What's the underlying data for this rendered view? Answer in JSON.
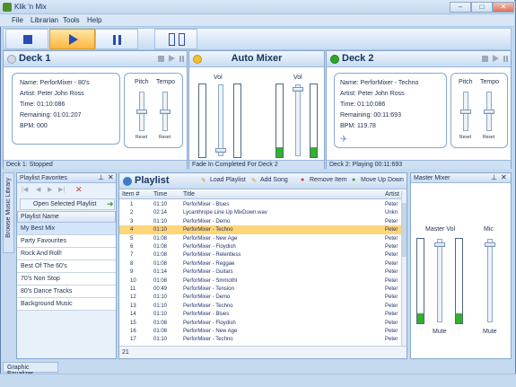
{
  "window": {
    "title": "Klik 'n Mix",
    "controls": [
      "–",
      "□",
      "✕"
    ]
  },
  "menu": [
    "File",
    "Librarian",
    "Tools",
    "Help"
  ],
  "deck1": {
    "title": "Deck 1",
    "name": "Name: PerforMixer - 80's",
    "artist": "Artist: Peter John Ross",
    "time": "Time: 01:10:086",
    "remaining": "Remaining: 01:01:207",
    "bpm": "BPM: 000",
    "pitch": "Pitch",
    "tempo": "Tempo",
    "reset": "Reset",
    "status": "Deck 1: Stopped"
  },
  "automixer": {
    "title": "Auto Mixer",
    "vol_left": "Vol",
    "vol_right": "Vol",
    "status": "Fade In Completed For Deck 2",
    "left_level": 0,
    "right_level": 0.15
  },
  "deck2": {
    "title": "Deck 2",
    "name": "Name: PerforMixer - Techno",
    "artist": "Artist: Peter John Ross",
    "time": "Time: 01:10:086",
    "remaining": "Remaining: 00:11:693",
    "bpm": "BPM: 119.78",
    "pitch": "Pitch",
    "tempo": "Tempo",
    "reset": "Reset",
    "status": "Deck 2: Playing 00:11:693"
  },
  "favorites": {
    "title": "Playlist Favorites",
    "open_button": "Open Selected Playlist",
    "column": "Playlist Name",
    "items": [
      "My Best Mix",
      "Party Favourites",
      "Rock And Roll!",
      "Best Of The 60's",
      "70's Non Stop",
      "80's Dance Tracks",
      "Background Music"
    ],
    "side_tab": "Browse Music Library"
  },
  "playlist": {
    "title": "Playlist",
    "actions": [
      "Load Playlist",
      "Add Song",
      "Remove Item",
      "Move Up Down"
    ],
    "columns": [
      "Item #",
      "Time",
      "Title",
      "Artist"
    ],
    "rows": [
      [
        "1",
        "01:10",
        "PerforMixer - Blues",
        "Peter"
      ],
      [
        "2",
        "02:14",
        "Lycanthrope Line Up MixDown.wav",
        "Unkn"
      ],
      [
        "3",
        "01:10",
        "PerforMixer - Demo",
        "Peter"
      ],
      [
        "4",
        "01:10",
        "PerforMixer - Techno",
        "Peter"
      ],
      [
        "5",
        "01:08",
        "PerforMixer - New Age",
        "Peter"
      ],
      [
        "6",
        "01:08",
        "PerforMixer - Floydish",
        "Peter"
      ],
      [
        "7",
        "01:08",
        "PerforMixer - Relentless",
        "Peter"
      ],
      [
        "8",
        "01:08",
        "PerforMixer - Reggae",
        "Peter"
      ],
      [
        "9",
        "01:14",
        "PerforMixer - Guitars",
        "Peter"
      ],
      [
        "10",
        "01:08",
        "PerforMixer - Smmothl",
        "Peter"
      ],
      [
        "11",
        "00:49",
        "PerforMixer - Tension",
        "Peter"
      ],
      [
        "12",
        "01:10",
        "PerforMixer - Demo",
        "Peter"
      ],
      [
        "13",
        "01:10",
        "PerforMixer - Techno",
        "Peter"
      ],
      [
        "14",
        "01:10",
        "PerforMixer - Blues",
        "Peter"
      ],
      [
        "15",
        "01:08",
        "PerforMixer - Floydish",
        "Peter"
      ],
      [
        "16",
        "01:08",
        "PerforMixer - New Age",
        "Peter"
      ],
      [
        "17",
        "01:10",
        "PerforMixer - Techno",
        "Peter"
      ]
    ],
    "count": "21",
    "selected_index": 3
  },
  "master": {
    "title": "Master Mixer",
    "master_vol": "Master Vol",
    "mic": "Mic",
    "mute1": "Mute",
    "mute2": "Mute"
  },
  "bottom_tab": "Graphic Equalizer"
}
